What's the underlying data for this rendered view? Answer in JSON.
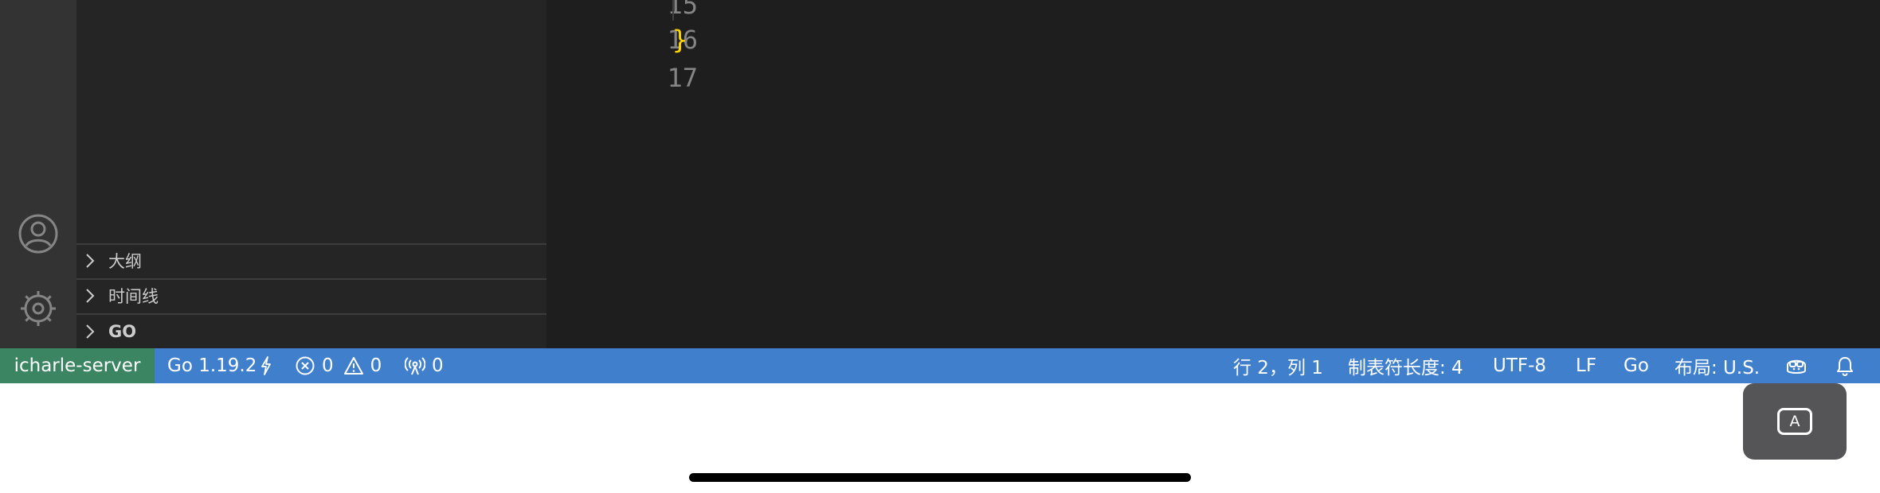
{
  "editor": {
    "lines": [
      {
        "number": "15",
        "text": ""
      },
      {
        "number": "16",
        "text": "}"
      },
      {
        "number": "17",
        "text": ""
      }
    ]
  },
  "sidebar": {
    "sections": [
      {
        "label": "大纲"
      },
      {
        "label": "时间线"
      },
      {
        "label": "GO"
      }
    ]
  },
  "statusbar": {
    "remote": "icharle-server",
    "go_version": "Go 1.19.2",
    "errors": "0",
    "warnings": "0",
    "ports": "0",
    "cursor_position": "行 2，列 1",
    "tab_size": "制表符长度: 4",
    "encoding": "UTF-8",
    "eol": "LF",
    "language": "Go",
    "keyboard_layout": "布局: U.S."
  },
  "ime": {
    "key": "A"
  },
  "colors": {
    "statusbar": "#3f7fcc",
    "remote": "#3b8562",
    "editor_bg": "#1e1e1e",
    "sidebar_bg": "#252526",
    "activitybar_bg": "#333333",
    "brace": "#ffd700"
  },
  "icons": [
    "accounts-icon",
    "settings-gear-icon",
    "chevron-right-icon",
    "lightning-icon",
    "error-icon",
    "warning-icon",
    "broadcast-icon",
    "copilot-icon",
    "bell-icon"
  ]
}
